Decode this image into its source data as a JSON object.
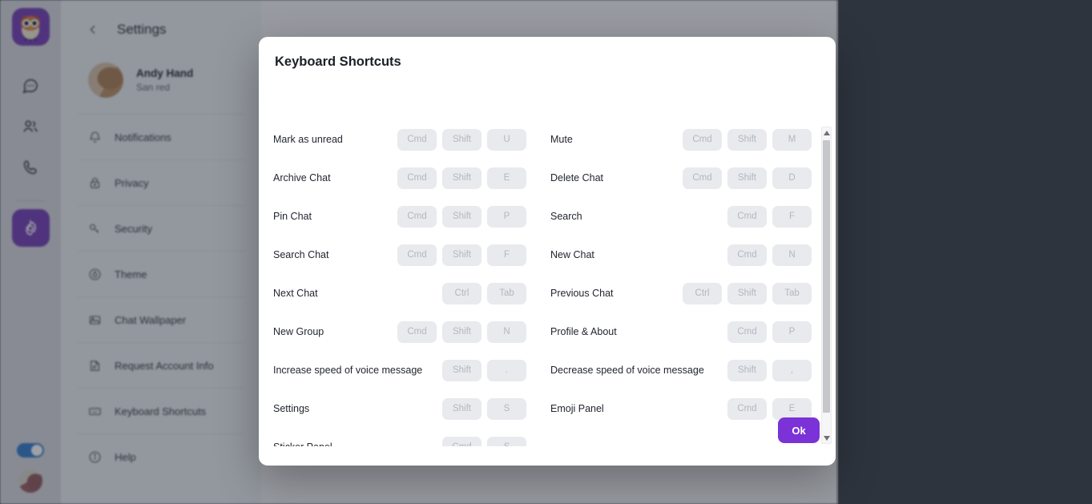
{
  "app": {
    "logo_icon": "owl-logo-icon",
    "rail_items": [
      {
        "icon": "chat-bubble-icon",
        "name": "chats",
        "active": false
      },
      {
        "icon": "contacts-icon",
        "name": "contacts",
        "active": false
      },
      {
        "icon": "phone-icon",
        "name": "calls",
        "active": false
      },
      {
        "icon": "gear-icon",
        "name": "settings",
        "active": true
      }
    ],
    "theme_toggle_on": true,
    "accent_color": "#7b32d6",
    "toggle_color": "#1a7ae8",
    "backdrop_color": "#2e343e"
  },
  "settings": {
    "back_icon": "chevron-left-icon",
    "title": "Settings",
    "profile": {
      "name": "Andy Hand",
      "status": "San red",
      "avatar": "user-avatar"
    },
    "items": [
      {
        "label": "Notifications",
        "icon": "bell-icon"
      },
      {
        "label": "Privacy",
        "icon": "lock-icon"
      },
      {
        "label": "Security",
        "icon": "key-icon"
      },
      {
        "label": "Theme",
        "icon": "droplet-icon"
      },
      {
        "label": "Chat Wallpaper",
        "icon": "image-icon"
      },
      {
        "label": "Request Account Info",
        "icon": "document-icon"
      },
      {
        "label": "Keyboard Shortcuts",
        "icon": "keyboard-icon"
      },
      {
        "label": "Help",
        "icon": "info-icon"
      }
    ]
  },
  "modal": {
    "title": "Keyboard Shortcuts",
    "ok_label": "Ok",
    "scrollbar": {
      "up_icon": "caret-up-icon",
      "down_icon": "caret-down-icon"
    },
    "rows": [
      {
        "left": {
          "label": "Mark as unread",
          "keys": [
            "Cmd",
            "Shift",
            "U"
          ]
        },
        "right": {
          "label": "Mute",
          "keys": [
            "Cmd",
            "Shift",
            "M"
          ]
        }
      },
      {
        "left": {
          "label": "Archive Chat",
          "keys": [
            "Cmd",
            "Shift",
            "E"
          ]
        },
        "right": {
          "label": "Delete Chat",
          "keys": [
            "Cmd",
            "Shift",
            "D"
          ]
        }
      },
      {
        "left": {
          "label": "Pin Chat",
          "keys": [
            "Cmd",
            "Shift",
            "P"
          ]
        },
        "right": {
          "label": "Search",
          "keys": [
            "Cmd",
            "F"
          ]
        }
      },
      {
        "left": {
          "label": "Search Chat",
          "keys": [
            "Cmd",
            "Shift",
            "F"
          ]
        },
        "right": {
          "label": "New Chat",
          "keys": [
            "Cmd",
            "N"
          ]
        }
      },
      {
        "left": {
          "label": "Next Chat",
          "keys": [
            "Ctrl",
            "Tab"
          ]
        },
        "right": {
          "label": "Previous Chat",
          "keys": [
            "Ctrl",
            "Shift",
            "Tab"
          ]
        }
      },
      {
        "left": {
          "label": "New Group",
          "keys": [
            "Cmd",
            "Shift",
            "N"
          ]
        },
        "right": {
          "label": "Profile & About",
          "keys": [
            "Cmd",
            "P"
          ]
        }
      },
      {
        "left": {
          "label": "Increase speed of voice message",
          "keys": [
            "Shift",
            "."
          ]
        },
        "right": {
          "label": "Decrease speed of voice message",
          "keys": [
            "Shift",
            ","
          ]
        }
      },
      {
        "left": {
          "label": "Settings",
          "keys": [
            "Shift",
            "S"
          ]
        },
        "right": {
          "label": "Emoji Panel",
          "keys": [
            "Cmd",
            "E"
          ]
        }
      },
      {
        "left": {
          "label": "Sticker Panel",
          "keys": [
            "Cmd",
            "S"
          ]
        },
        "right": {
          "label": "",
          "keys": []
        }
      }
    ]
  }
}
